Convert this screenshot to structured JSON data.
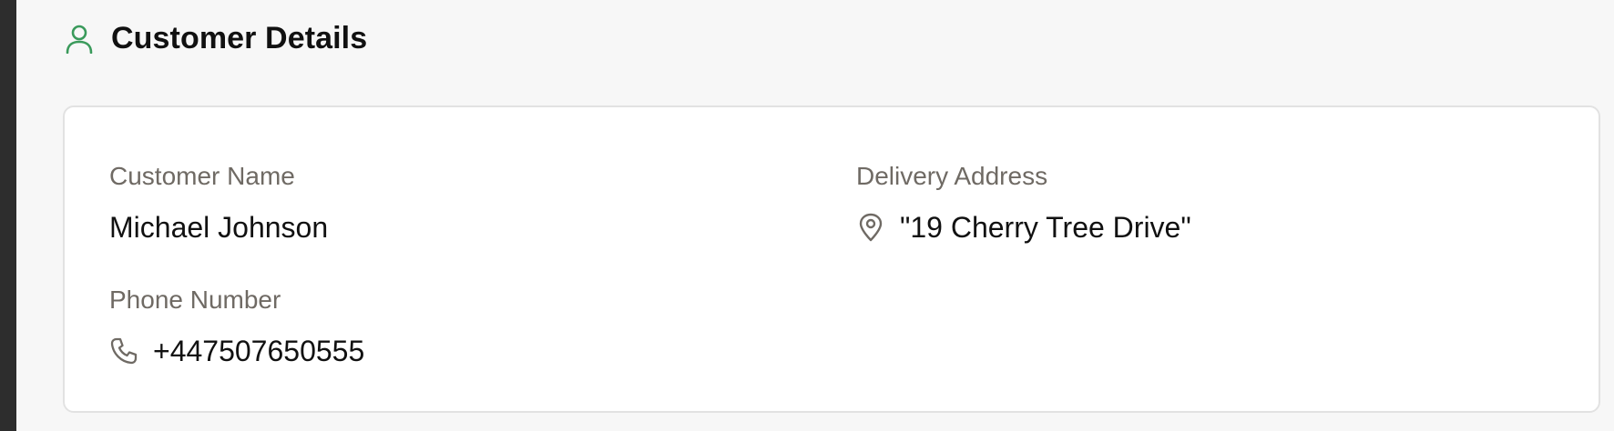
{
  "colors": {
    "accent_green": "#3a9a5b",
    "label_gray": "#6f6a64",
    "value_text": "#111111",
    "card_border": "#e2e2e2"
  },
  "section": {
    "icon": "user-icon",
    "title": "Customer Details"
  },
  "customer": {
    "name_label": "Customer Name",
    "name_value": "Michael Johnson",
    "address_label": "Delivery Address",
    "address_icon": "map-pin-icon",
    "address_value": "\"19 Cherry Tree Drive\"",
    "phone_label": "Phone Number",
    "phone_icon": "phone-icon",
    "phone_value": "+447507650555"
  }
}
